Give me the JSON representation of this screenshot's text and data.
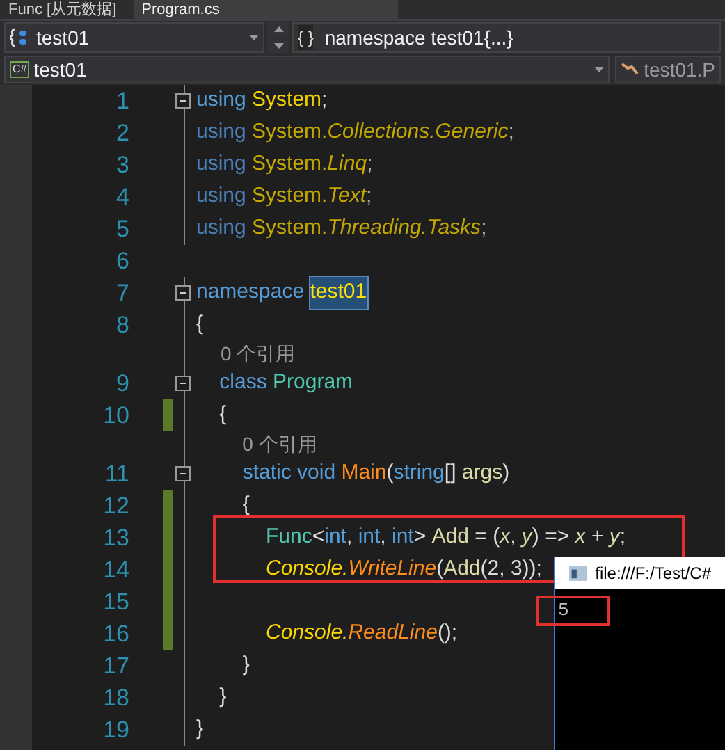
{
  "tabs": [
    {
      "label": "Func [从元数据]",
      "selected": false
    },
    {
      "label": "Program.cs",
      "selected": true
    }
  ],
  "nav_bar": {
    "project": "test01",
    "scope_icon": "{ }",
    "scope": "namespace test01{...}"
  },
  "nav_bar_2": {
    "file_icon": "C#",
    "file": "test01",
    "member": "test01.P"
  },
  "editor": {
    "lines": [
      {
        "kind": "code",
        "number": "1",
        "collapsible": true,
        "guide": true,
        "modified": false,
        "tokens": [
          {
            "text": "using ",
            "kind": "kw"
          },
          {
            "text": "System",
            "kind": "ns"
          },
          {
            "text": ";",
            "kind": "punct"
          }
        ]
      },
      {
        "kind": "code",
        "number": "2",
        "collapsible": false,
        "guide": true,
        "modified": false,
        "tokens": [
          {
            "text": "using ",
            "kind": "kwdim"
          },
          {
            "text": "System.",
            "kind": "nsdim"
          },
          {
            "text": "Collections.Generic",
            "kind": "nsitalic"
          },
          {
            "text": ";",
            "kind": "punctdim"
          }
        ]
      },
      {
        "kind": "code",
        "number": "3",
        "collapsible": false,
        "guide": true,
        "modified": false,
        "tokens": [
          {
            "text": "using ",
            "kind": "kwdim"
          },
          {
            "text": "System.",
            "kind": "nsdim"
          },
          {
            "text": "Linq",
            "kind": "nsitalic"
          },
          {
            "text": ";",
            "kind": "punctdim"
          }
        ]
      },
      {
        "kind": "code",
        "number": "4",
        "collapsible": false,
        "guide": true,
        "modified": false,
        "tokens": [
          {
            "text": "using ",
            "kind": "kwdim"
          },
          {
            "text": "System.",
            "kind": "nsdim"
          },
          {
            "text": "Text",
            "kind": "nsitalic"
          },
          {
            "text": ";",
            "kind": "punctdim"
          }
        ]
      },
      {
        "kind": "code",
        "number": "5",
        "collapsible": false,
        "guide": true,
        "modified": false,
        "tokens": [
          {
            "text": "using ",
            "kind": "kwdim"
          },
          {
            "text": "System.",
            "kind": "nsdim"
          },
          {
            "text": "Threading.Tasks",
            "kind": "nsitalic"
          },
          {
            "text": ";",
            "kind": "punctdim"
          }
        ]
      },
      {
        "kind": "code",
        "number": "6",
        "collapsible": false,
        "guide": false,
        "modified": false
      },
      {
        "kind": "code",
        "number": "7",
        "collapsible": true,
        "guide": true,
        "modified": false,
        "tokens": [
          {
            "text": "namespace ",
            "kind": "kw"
          },
          {
            "text": "test01",
            "kind": "selection"
          }
        ]
      },
      {
        "kind": "code",
        "number": "8",
        "collapsible": false,
        "guide": true,
        "modified": false,
        "tokens": [
          {
            "text": "{",
            "kind": "punct"
          }
        ]
      },
      {
        "kind": "codelens",
        "guide": true,
        "text": "    0 个引用"
      },
      {
        "kind": "code",
        "number": "9",
        "collapsible": true,
        "guide": true,
        "modified": false,
        "tokens": [
          {
            "text": "    class ",
            "kind": "kw"
          },
          {
            "text": "Program",
            "kind": "type"
          }
        ]
      },
      {
        "kind": "code",
        "number": "10",
        "collapsible": false,
        "guide": true,
        "modified": true,
        "tokens": [
          {
            "text": "    {",
            "kind": "punct"
          }
        ]
      },
      {
        "kind": "codelens",
        "guide": true,
        "text": "        0 个引用"
      },
      {
        "kind": "code",
        "number": "11",
        "collapsible": true,
        "guide": true,
        "modified": false,
        "tokens": [
          {
            "text": "        static void ",
            "kind": "kw"
          },
          {
            "text": "Main",
            "kind": "method"
          },
          {
            "text": "(",
            "kind": "punct"
          },
          {
            "text": "string",
            "kind": "kw"
          },
          {
            "text": "[] ",
            "kind": "punct"
          },
          {
            "text": "args",
            "kind": "ident"
          },
          {
            "text": ")",
            "kind": "punct"
          }
        ]
      },
      {
        "kind": "code",
        "number": "12",
        "collapsible": false,
        "guide": true,
        "modified": true,
        "tokens": [
          {
            "text": "        {",
            "kind": "punct"
          }
        ]
      },
      {
        "kind": "code",
        "number": "13",
        "collapsible": false,
        "guide": true,
        "modified": true,
        "tokens": [
          {
            "text": "            Func",
            "kind": "type"
          },
          {
            "text": "<",
            "kind": "punct"
          },
          {
            "text": "int",
            "kind": "kw"
          },
          {
            "text": ", ",
            "kind": "punct"
          },
          {
            "text": "int",
            "kind": "kw"
          },
          {
            "text": ", ",
            "kind": "punct"
          },
          {
            "text": "int",
            "kind": "kw"
          },
          {
            "text": "> ",
            "kind": "punct"
          },
          {
            "text": "Add",
            "kind": "ident"
          },
          {
            "text": " = (",
            "kind": "punct"
          },
          {
            "text": "x",
            "kind": "param"
          },
          {
            "text": ", ",
            "kind": "punct"
          },
          {
            "text": "y",
            "kind": "param"
          },
          {
            "text": ") => ",
            "kind": "punct"
          },
          {
            "text": "x",
            "kind": "param"
          },
          {
            "text": " + ",
            "kind": "punct"
          },
          {
            "text": "y",
            "kind": "param"
          },
          {
            "text": ";",
            "kind": "punct"
          }
        ]
      },
      {
        "kind": "code",
        "number": "14",
        "collapsible": false,
        "guide": true,
        "modified": true,
        "tokens": [
          {
            "text": "            Console.",
            "kind": "static"
          },
          {
            "text": "WriteLine",
            "kind": "methoditalic"
          },
          {
            "text": "(",
            "kind": "punct"
          },
          {
            "text": "Add",
            "kind": "ident"
          },
          {
            "text": "(2, 3));",
            "kind": "punct"
          }
        ]
      },
      {
        "kind": "code",
        "number": "15",
        "collapsible": false,
        "guide": true,
        "modified": true
      },
      {
        "kind": "code",
        "number": "16",
        "collapsible": false,
        "guide": true,
        "modified": true,
        "tokens": [
          {
            "text": "            Console.",
            "kind": "static"
          },
          {
            "text": "ReadLine",
            "kind": "methoditalic"
          },
          {
            "text": "();",
            "kind": "punct"
          }
        ]
      },
      {
        "kind": "code",
        "number": "17",
        "collapsible": false,
        "guide": true,
        "modified": false,
        "tokens": [
          {
            "text": "        }",
            "kind": "punct"
          }
        ]
      },
      {
        "kind": "code",
        "number": "18",
        "collapsible": false,
        "guide": true,
        "modified": false,
        "tokens": [
          {
            "text": "    }",
            "kind": "punct"
          }
        ]
      },
      {
        "kind": "code",
        "number": "19",
        "collapsible": false,
        "guide": true,
        "modified": false,
        "tokens": [
          {
            "text": "}",
            "kind": "punct"
          }
        ]
      }
    ]
  },
  "console": {
    "title": "file:///F:/Test/C#",
    "output": "5"
  }
}
